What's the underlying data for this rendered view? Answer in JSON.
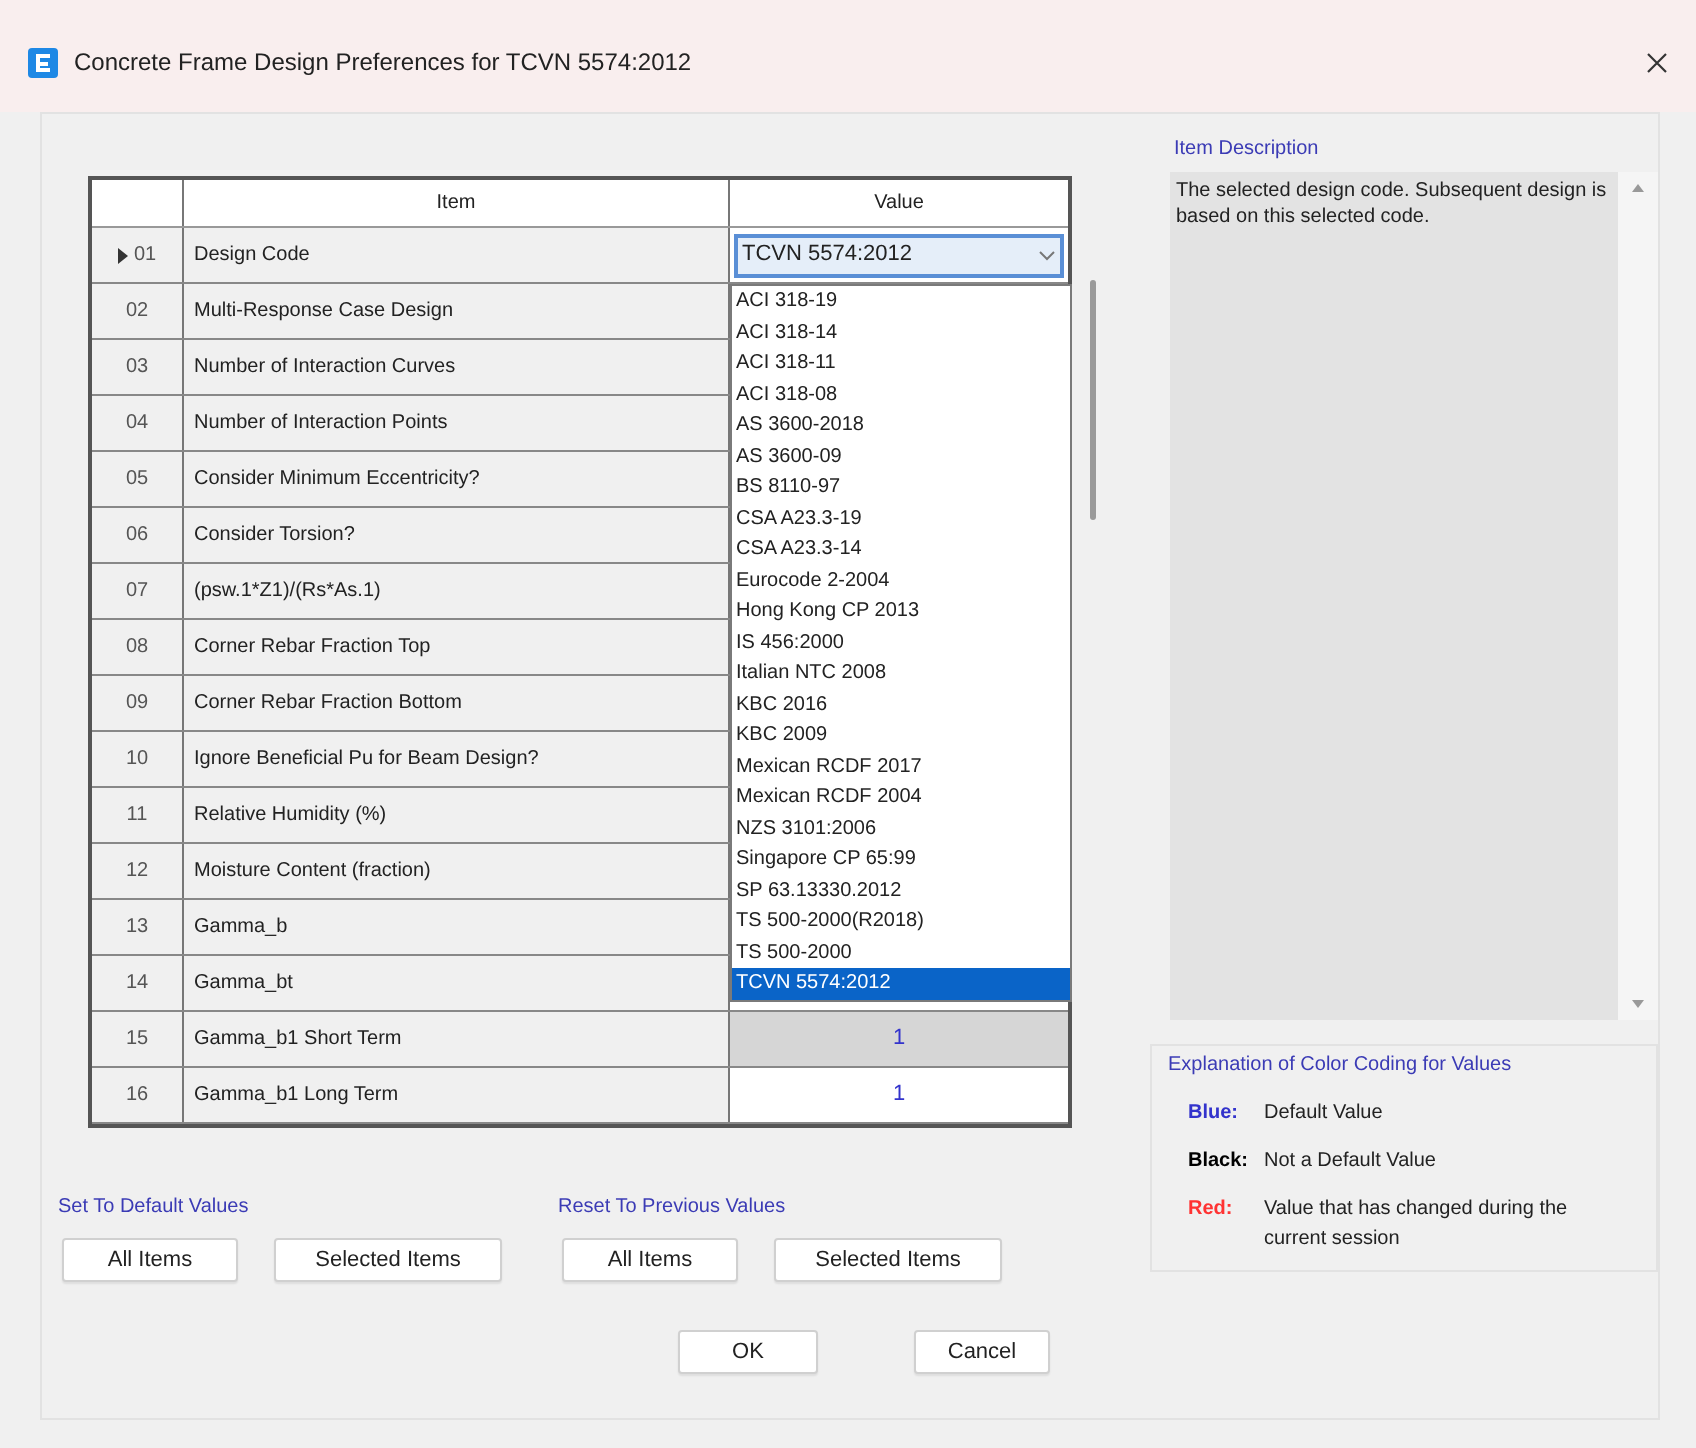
{
  "window": {
    "title": "Concrete Frame Design Preferences for TCVN 5574:2012"
  },
  "table": {
    "columns": [
      "Item",
      "Value"
    ],
    "rows": [
      {
        "number": "01",
        "item": "Design Code",
        "value": "TCVN 5574:2012",
        "current": true
      },
      {
        "number": "02",
        "item": "Multi-Response Case Design",
        "current": false
      },
      {
        "number": "03",
        "item": "Number of Interaction Curves",
        "current": false
      },
      {
        "number": "04",
        "item": "Number of Interaction Points",
        "current": false
      },
      {
        "number": "05",
        "item": "Consider Minimum Eccentricity?",
        "current": false
      },
      {
        "number": "06",
        "item": "Consider Torsion?",
        "current": false
      },
      {
        "number": "07",
        "item": "(psw.1*Z1)/(Rs*As.1)",
        "current": false
      },
      {
        "number": "08",
        "item": "Corner Rebar Fraction Top",
        "current": false
      },
      {
        "number": "09",
        "item": "Corner Rebar Fraction Bottom",
        "current": false
      },
      {
        "number": "10",
        "item": "Ignore Beneficial Pu for Beam Design?",
        "current": false
      },
      {
        "number": "11",
        "item": "Relative Humidity (%)",
        "current": false
      },
      {
        "number": "12",
        "item": "Moisture Content (fraction)",
        "current": false
      },
      {
        "number": "13",
        "item": "Gamma_b",
        "current": false
      },
      {
        "number": "14",
        "item": "Gamma_bt",
        "current": false
      },
      {
        "number": "15",
        "item": "Gamma_b1 Short Term",
        "value": "1",
        "current": false,
        "value_selected": true
      },
      {
        "number": "16",
        "item": "Gamma_b1 Long Term",
        "value": "1",
        "current": false,
        "value_selected": false
      }
    ]
  },
  "dropdown": {
    "options": [
      {
        "label": "ACI 318-19",
        "selected": false
      },
      {
        "label": "ACI 318-14",
        "selected": false
      },
      {
        "label": "ACI 318-11",
        "selected": false
      },
      {
        "label": "ACI 318-08",
        "selected": false
      },
      {
        "label": "AS 3600-2018",
        "selected": false
      },
      {
        "label": "AS 3600-09",
        "selected": false
      },
      {
        "label": "BS 8110-97",
        "selected": false
      },
      {
        "label": "CSA A23.3-19",
        "selected": false
      },
      {
        "label": "CSA A23.3-14",
        "selected": false
      },
      {
        "label": "Eurocode 2-2004",
        "selected": false
      },
      {
        "label": "Hong Kong CP 2013",
        "selected": false
      },
      {
        "label": "IS 456:2000",
        "selected": false
      },
      {
        "label": "Italian NTC 2008",
        "selected": false
      },
      {
        "label": "KBC 2016",
        "selected": false
      },
      {
        "label": "KBC 2009",
        "selected": false
      },
      {
        "label": "Mexican RCDF 2017",
        "selected": false
      },
      {
        "label": "Mexican RCDF 2004",
        "selected": false
      },
      {
        "label": "NZS 3101:2006",
        "selected": false
      },
      {
        "label": "Singapore CP 65:99",
        "selected": false
      },
      {
        "label": "SP 63.13330.2012",
        "selected": false
      },
      {
        "label": "TS 500-2000(R2018)",
        "selected": false
      },
      {
        "label": "TS 500-2000",
        "selected": false
      },
      {
        "label": "TCVN 5574:2012",
        "selected": true
      }
    ]
  },
  "item_description": {
    "label": "Item Description",
    "text": "The selected design code. Subsequent design is based on this selected code."
  },
  "color_coding": {
    "label": "Explanation of Color Coding for Values",
    "entries": [
      {
        "name": "Blue:",
        "meaning": "Default Value",
        "color": "#3333cc"
      },
      {
        "name": "Black:",
        "meaning": "Not a Default Value",
        "color": "#000000"
      },
      {
        "name": "Red:",
        "meaning": "Value that has changed during the current session",
        "color": "#ff3333"
      }
    ]
  },
  "button_groups": [
    {
      "label": "Set To Default Values",
      "buttons": [
        "All Items",
        "Selected Items"
      ]
    },
    {
      "label": "Reset To Previous Values",
      "buttons": [
        "All Items",
        "Selected Items"
      ]
    }
  ],
  "buttons": [
    "OK",
    "Cancel"
  ]
}
